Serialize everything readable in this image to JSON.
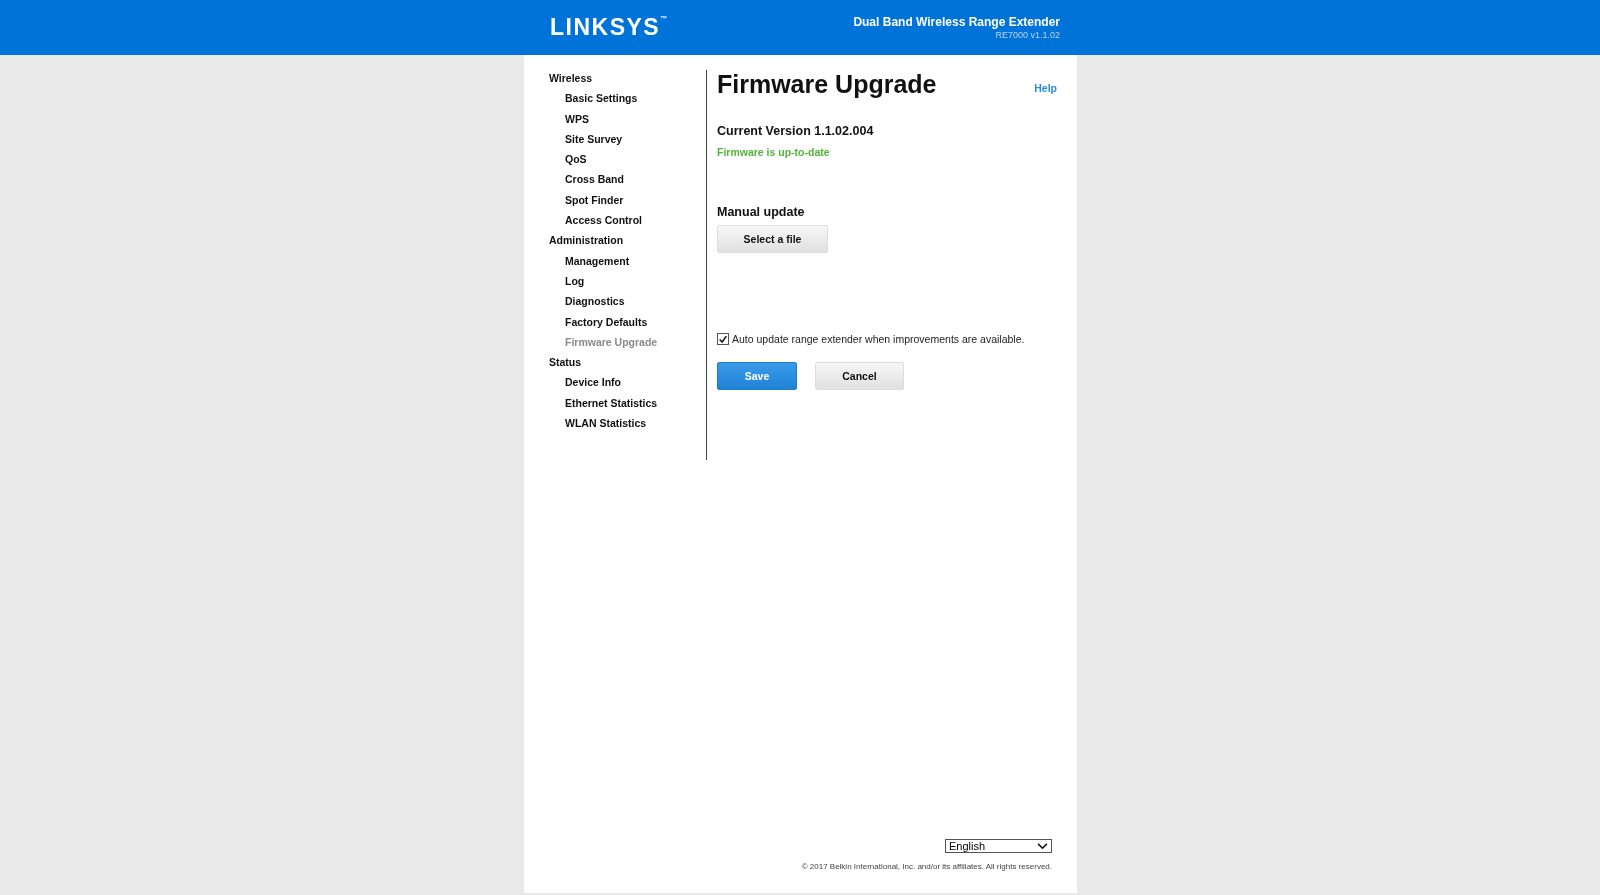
{
  "header": {
    "logo": "LINKSYS$^{™}$",
    "product": "Dual Band Wireless Range Extender",
    "model": "RE7000 v1.1.02"
  },
  "sidebar": {
    "groups": [
      {
        "label": "Wireless",
        "children": [
          {
            "label": "Basic Settings",
            "selected": false
          },
          {
            "label": "WPS",
            "selected": false
          },
          {
            "label": "Site Survey",
            "selected": false
          },
          {
            "label": "QoS",
            "selected": false
          },
          {
            "label": "Cross Band",
            "selected": false
          },
          {
            "label": "Spot Finder",
            "selected": false
          },
          {
            "label": "Access Control",
            "selected": false
          }
        ]
      },
      {
        "label": "Administration",
        "children": [
          {
            "label": "Management",
            "selected": false
          },
          {
            "label": "Log",
            "selected": false
          },
          {
            "label": "Diagnostics",
            "selected": false
          },
          {
            "label": "Factory Defaults",
            "selected": false
          },
          {
            "label": "Firmware Upgrade",
            "selected": true
          }
        ]
      },
      {
        "label": "Status",
        "children": [
          {
            "label": "Device Info",
            "selected": false
          },
          {
            "label": "Ethernet Statistics",
            "selected": false
          },
          {
            "label": "WLAN Statistics",
            "selected": false
          }
        ]
      }
    ]
  },
  "page": {
    "title": "Firmware Upgrade",
    "help": "Help",
    "current_version": "Current Version 1.1.02.004",
    "status": "Firmware is up-to-date",
    "manual_update": "Manual update",
    "select_file": "Select a file",
    "auto_update": {
      "label": "Auto update range extender when improvements are available.",
      "checked": true
    },
    "buttons": [
      {
        "label": "Save",
        "kind": "primary"
      },
      {
        "label": "Cancel",
        "kind": "secondary"
      }
    ]
  },
  "footer": {
    "language": "English",
    "copyright": "© 2017 Belkin International, Inc. and/or its affiliates. All rights reserved."
  }
}
